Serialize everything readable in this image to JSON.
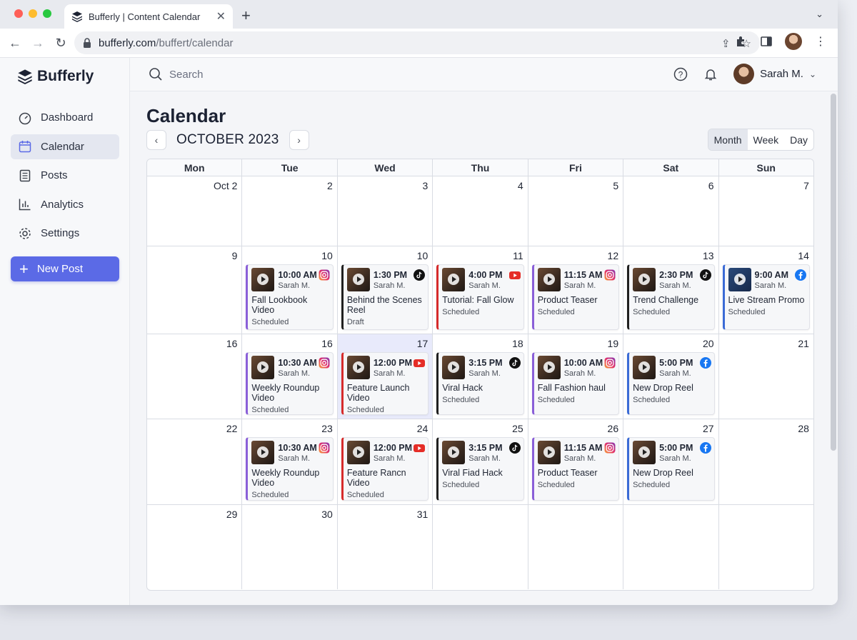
{
  "browser": {
    "tab_title": "Bufferly | Content Calendar",
    "url_host": "bufferly.com",
    "url_path": "/buffert/calendar"
  },
  "sidebar": {
    "brand": "Bufferly",
    "items": [
      {
        "label": "Dashboard",
        "icon": "gauge-icon"
      },
      {
        "label": "Calendar",
        "icon": "calendar-icon",
        "active": true
      },
      {
        "label": "Posts",
        "icon": "document-icon"
      },
      {
        "label": "Analytics",
        "icon": "bar-chart-icon"
      },
      {
        "label": "Settings",
        "icon": "gear-icon"
      }
    ],
    "new_post": "New Post"
  },
  "topbar": {
    "search_placeholder": "Search",
    "user_name": "Sarah M."
  },
  "calendar": {
    "title": "Calendar",
    "month_label": "OCTOBER 2023",
    "views": [
      "Month",
      "Week",
      "Day"
    ],
    "active_view": "Month",
    "weekdays": [
      "Mon",
      "Tue",
      "Wed",
      "Thu",
      "Fri",
      "Sat",
      "Sun"
    ],
    "weeks": [
      {
        "days": [
          {
            "num": "Oct 2"
          },
          {
            "num": "2"
          },
          {
            "num": "3"
          },
          {
            "num": "4"
          },
          {
            "num": "5"
          },
          {
            "num": "6"
          },
          {
            "num": "7"
          }
        ]
      },
      {
        "days": [
          {
            "num": "9"
          },
          {
            "num": "10",
            "post": {
              "time": "10:00 AM",
              "author": "Sarah M.",
              "title": "Fall Lookbook Video",
              "status": "Scheduled",
              "network": "ig"
            }
          },
          {
            "num": "10",
            "post": {
              "time": "1:30 PM",
              "author": "Sarah M.",
              "title": "Behind the Scenes Reel",
              "status": "Draft",
              "network": "tt"
            }
          },
          {
            "num": "11",
            "post": {
              "time": "4:00 PM",
              "author": "Sarah M.",
              "title": "Tutorial: Fall Glow",
              "status": "Scheduled",
              "network": "yt"
            }
          },
          {
            "num": "12",
            "post": {
              "time": "11:15 AM",
              "author": "Sarah M.",
              "title": "Product Teaser",
              "status": "Scheduled",
              "network": "ig"
            }
          },
          {
            "num": "13",
            "post": {
              "time": "2:30 PM",
              "author": "Sarah M.",
              "title": "Trend Challenge",
              "status": "Scheduled",
              "network": "tt"
            }
          },
          {
            "num": "14",
            "post": {
              "time": "9:00 AM",
              "author": "Sarah M.",
              "title": "Live Stream Promo",
              "status": "Scheduled",
              "network": "fb"
            }
          }
        ]
      },
      {
        "days": [
          {
            "num": "16"
          },
          {
            "num": "16",
            "post": {
              "time": "10:30 AM",
              "author": "Sarah M.",
              "title": "Weekly Roundup Video",
              "status": "Scheduled",
              "network": "ig"
            }
          },
          {
            "num": "17",
            "today": true,
            "post": {
              "time": "12:00 PM",
              "author": "Sarah M.",
              "title": "Feature Launch Video",
              "status": "Scheduled",
              "network": "yt"
            }
          },
          {
            "num": "18",
            "post": {
              "time": "3:15 PM",
              "author": "Sarah M.",
              "title": "Viral Hack",
              "status": "Scheduled",
              "network": "tt"
            }
          },
          {
            "num": "19",
            "post": {
              "time": "10:00 AM",
              "author": "Sarah M.",
              "title": "Fall Fashion haul",
              "status": "Scheduled",
              "network": "ig"
            }
          },
          {
            "num": "20",
            "post": {
              "time": "5:00 PM",
              "author": "Sarah M.",
              "title": "New Drop Reel",
              "status": "Scheduled",
              "network": "fb"
            }
          },
          {
            "num": "21"
          }
        ]
      },
      {
        "days": [
          {
            "num": "22"
          },
          {
            "num": "23",
            "post": {
              "time": "10:30 AM",
              "author": "Sarah M.",
              "title": "Weekly Roundup Video",
              "status": "Scheduled",
              "network": "ig"
            }
          },
          {
            "num": "24",
            "post": {
              "time": "12:00 PM",
              "author": "Sarah M.",
              "title": "Feature Rancn Video",
              "status": "Scheduled",
              "network": "yt"
            }
          },
          {
            "num": "25",
            "post": {
              "time": "3:15 PM",
              "author": "Sarah M.",
              "title": "Viral Fiad Hack",
              "status": "Scheduled",
              "network": "tt"
            }
          },
          {
            "num": "26",
            "post": {
              "time": "11:15 AM",
              "author": "Sarah M.",
              "title": "Product Teaser",
              "status": "Scheduled",
              "network": "ig"
            }
          },
          {
            "num": "27",
            "post": {
              "time": "5:00 PM",
              "author": "Sarah M.",
              "title": "New Drop Reel",
              "status": "Scheduled",
              "network": "fb"
            }
          },
          {
            "num": "28"
          }
        ]
      },
      {
        "days": [
          {
            "num": "29"
          },
          {
            "num": "30"
          },
          {
            "num": "31"
          },
          {
            "num": ""
          },
          {
            "num": ""
          },
          {
            "num": ""
          },
          {
            "num": ""
          }
        ]
      }
    ]
  },
  "colors": {
    "accent": "#5b6ae6",
    "instagram": "#8a5fd8",
    "youtube": "#d62b2b",
    "tiktok": "#202020",
    "facebook": "#3b6bd6",
    "today_bg": "#e8eafb"
  }
}
